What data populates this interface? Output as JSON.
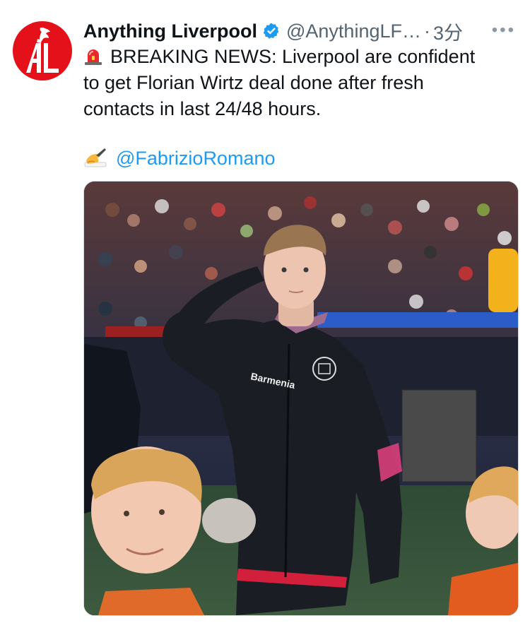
{
  "tweet": {
    "display_name": "Anything Liverpool",
    "handle": "@AnythingLF…",
    "separator": "·",
    "time": "3分",
    "more": "•••",
    "text_line1": "BREAKING NEWS: Liverpool are confident",
    "text_line2": "to get Florian Wirtz deal done after fresh",
    "text_line3": "contacts in last 24/48 hours.",
    "mention": "@FabrizioRomano",
    "avatar_initials": "AL",
    "jacket_sponsor": "Barmenia"
  },
  "icons": {
    "avatar": "anything-liverpool-logo",
    "verified": "verified-badge-icon",
    "siren": "siren-emoji",
    "writing_hand": "writing-hand-emoji",
    "more": "more-options-icon"
  },
  "colors": {
    "brand_red": "#e4101a",
    "link_blue": "#1d9bf0",
    "verified_blue": "#1d9bf0",
    "secondary_text": "#536471"
  }
}
